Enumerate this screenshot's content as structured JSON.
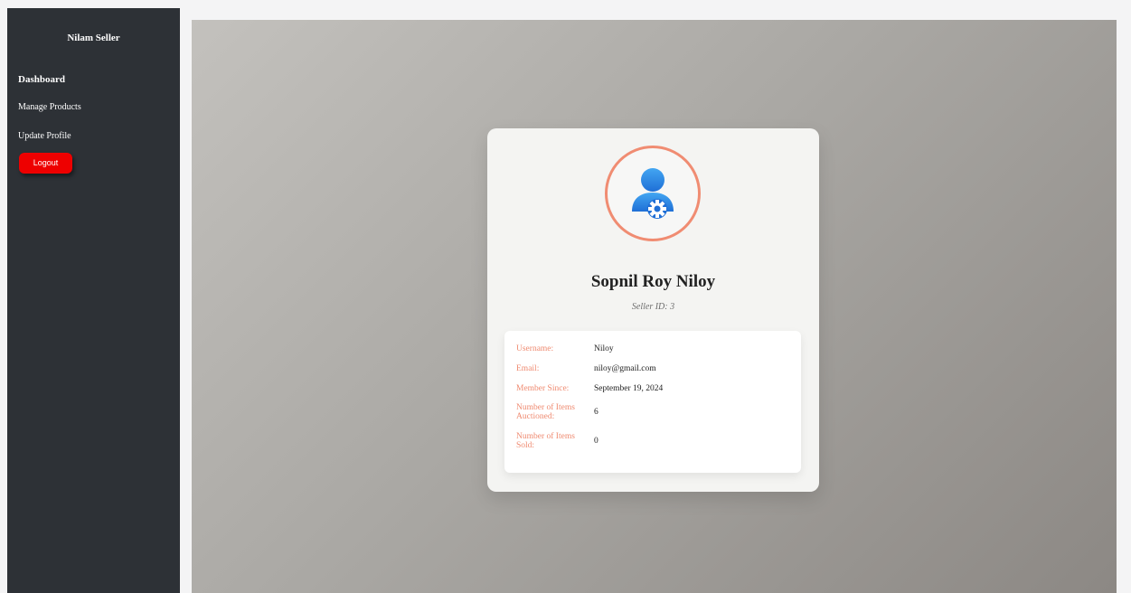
{
  "sidebar": {
    "brand": "Nilam Seller",
    "items": [
      {
        "label": "Dashboard"
      },
      {
        "label": "Manage Products"
      },
      {
        "label": "Update Profile"
      }
    ],
    "logout_label": "Logout"
  },
  "profile": {
    "name": "Sopnil Roy Niloy",
    "seller_id_label": "Seller ID:",
    "seller_id": "3",
    "fields": [
      {
        "label": "Username:",
        "value": "Niloy"
      },
      {
        "label": "Email:",
        "value": "niloy@gmail.com"
      },
      {
        "label": "Member Since:",
        "value": "September 19, 2024"
      },
      {
        "label": "Number of Items Auctioned:",
        "value": "6"
      },
      {
        "label": "Number of Items Sold:",
        "value": "0"
      }
    ]
  },
  "colors": {
    "sidebar_bg": "#2d3136",
    "logout_bg": "#ee0000",
    "accent": "#ef8a70",
    "avatar_blue": "#2f8fe6"
  },
  "icons": {
    "avatar": "user-gear-icon"
  }
}
